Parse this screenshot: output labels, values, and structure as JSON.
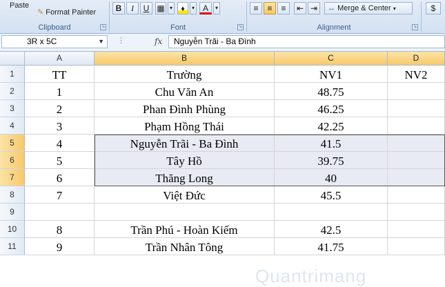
{
  "ribbon": {
    "clipboard": {
      "paste_label": "Paste",
      "format_painter_label": "Format Painter",
      "group_label": "Clipboard"
    },
    "font": {
      "bold": "B",
      "italic": "I",
      "underline": "U",
      "font_color_letter": "A",
      "group_label": "Font"
    },
    "alignment": {
      "merge_label": "Merge & Center",
      "group_label": "Alignment"
    },
    "number": {
      "currency_symbol": "$"
    }
  },
  "formula_bar": {
    "name_box": "3R x 5C",
    "fx_label": "fx",
    "formula": "Nguyễn Trãi - Ba Đình"
  },
  "grid": {
    "columns": [
      "A",
      "B",
      "C",
      "D"
    ],
    "rows": [
      {
        "num": "1",
        "a": "TT",
        "b": "Trường",
        "c": "NV1",
        "d": "NV2"
      },
      {
        "num": "2",
        "a": "1",
        "b": "Chu Văn An",
        "c": "48.75",
        "d": ""
      },
      {
        "num": "3",
        "a": "2",
        "b": "Phan Đình Phùng",
        "c": "46.25",
        "d": ""
      },
      {
        "num": "4",
        "a": "3",
        "b": "Phạm Hồng Thái",
        "c": "42.25",
        "d": ""
      },
      {
        "num": "5",
        "a": "4",
        "b": "Nguyễn Trãi - Ba Đình",
        "c": "41.5",
        "d": ""
      },
      {
        "num": "6",
        "a": "5",
        "b": "Tây Hồ",
        "c": "39.75",
        "d": ""
      },
      {
        "num": "7",
        "a": "6",
        "b": "Thăng Long",
        "c": "40",
        "d": ""
      },
      {
        "num": "8",
        "a": "7",
        "b": "Việt Đức",
        "c": "45.5",
        "d": ""
      },
      {
        "num": "9",
        "a": "",
        "b": "",
        "c": "",
        "d": ""
      },
      {
        "num": "10",
        "a": "8",
        "b": "Trần Phú - Hoàn Kiếm",
        "c": "42.5",
        "d": ""
      },
      {
        "num": "11",
        "a": "9",
        "b": "Trần Nhân Tông",
        "c": "41.75",
        "d": ""
      }
    ]
  },
  "watermark": "Quantrimang",
  "colors": {
    "selection_fill": "#e8ebf3",
    "header_selected": "#f7c96a",
    "ribbon_bg": "#d3e1f1"
  }
}
